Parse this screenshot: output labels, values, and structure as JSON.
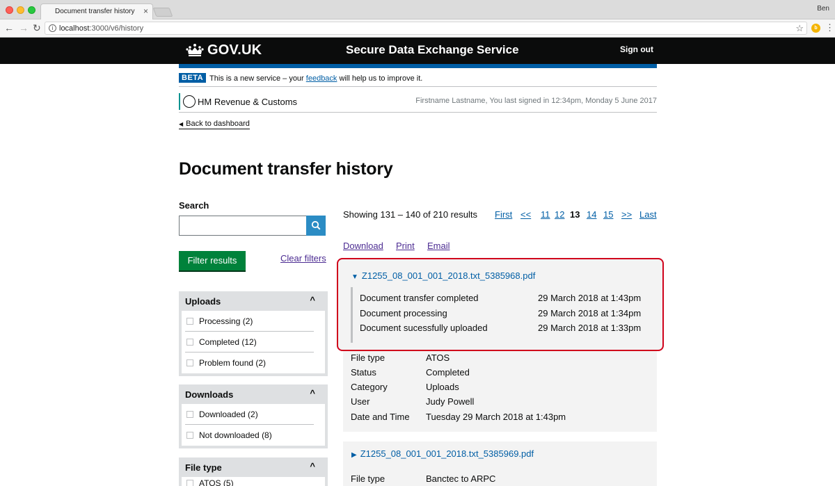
{
  "browser": {
    "tab_title": "Document transfer history",
    "tab_close": "×",
    "url_host": "localhost",
    "url_rest": ":3000/v6/history",
    "user": "Ben"
  },
  "header": {
    "logo": "GOV.UK",
    "service": "Secure Data Exchange Service",
    "signout": "Sign out"
  },
  "phase": {
    "tag": "BETA",
    "text_before": "This is a new service – your ",
    "link": "feedback",
    "text_after": " will help us to improve it."
  },
  "org": {
    "name": "HM Revenue & Customs",
    "signed_in": "Firstname Lastname, You last signed in 12:34pm, Monday 5 June 2017"
  },
  "back_link": "Back to dashboard",
  "page_title": "Document transfer history",
  "search": {
    "label": "Search",
    "placeholder": ""
  },
  "filter_button": "Filter results",
  "clear_filters": "Clear filters",
  "facets": {
    "uploads": {
      "title": "Uploads",
      "options": [
        "Processing (2)",
        "Completed (12)",
        "Problem found (2)"
      ]
    },
    "downloads": {
      "title": "Downloads",
      "options": [
        "Downloaded (2)",
        "Not downloaded (8)"
      ]
    },
    "filetype": {
      "title": "File type",
      "options": [
        "ATOS (5)"
      ]
    }
  },
  "results": {
    "showing": "Showing 131 – 140 of 210 results",
    "pagination": [
      "First",
      "<<",
      "11",
      "12",
      "13",
      "14",
      "15",
      ">>",
      "Last"
    ],
    "current_page": "13",
    "actions": [
      "Download",
      "Print",
      "Email"
    ]
  },
  "records": [
    {
      "filename": "Z1255_08_001_001_2018.txt_5385968.pdf",
      "events": [
        {
          "label": "Document transfer completed",
          "date": "29 March 2018 at 1:43pm"
        },
        {
          "label": "Document processing",
          "date": "29 March 2018 at 1:34pm"
        },
        {
          "label": "Document sucessfully uploaded",
          "date": "29 March 2018 at 1:33pm"
        }
      ],
      "meta": [
        {
          "k": "File type",
          "v": "ATOS"
        },
        {
          "k": "Status",
          "v": "Completed"
        },
        {
          "k": "Category",
          "v": "Uploads"
        },
        {
          "k": "User",
          "v": "Judy Powell"
        },
        {
          "k": "Date and Time",
          "v": "Tuesday 29 March 2018 at 1:43pm"
        }
      ]
    },
    {
      "filename": "Z1255_08_001_001_2018.txt_5385969.pdf",
      "meta": [
        {
          "k": "File type",
          "v": "Banctec to ARPC"
        }
      ]
    }
  ],
  "colors": {
    "govuk_black": "#0b0c0c",
    "govuk_blue": "#005ea5",
    "button_green": "#00823b",
    "search_blue": "#2b8cc4",
    "highlight_red": "#d0021b"
  }
}
